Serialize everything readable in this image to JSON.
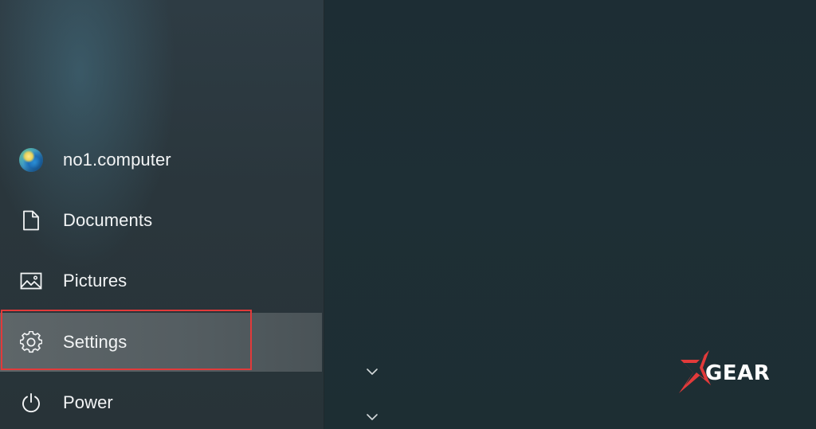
{
  "start_menu": {
    "items": [
      {
        "label": "no1.computer",
        "icon": "user-avatar-icon"
      },
      {
        "label": "Documents",
        "icon": "document-icon"
      },
      {
        "label": "Pictures",
        "icon": "pictures-icon"
      },
      {
        "label": "Settings",
        "icon": "gear-icon",
        "highlighted": true
      },
      {
        "label": "Power",
        "icon": "power-icon"
      }
    ]
  },
  "chevrons": [
    "chevron-down-icon",
    "chevron-down-icon"
  ],
  "watermark": {
    "text": "GEAR",
    "logo_mark": "X"
  },
  "colors": {
    "highlight_border": "#e23a3a",
    "pane_bg": "#2a363c",
    "right_bg": "#1e2f35",
    "text": "#f2f4f5"
  }
}
